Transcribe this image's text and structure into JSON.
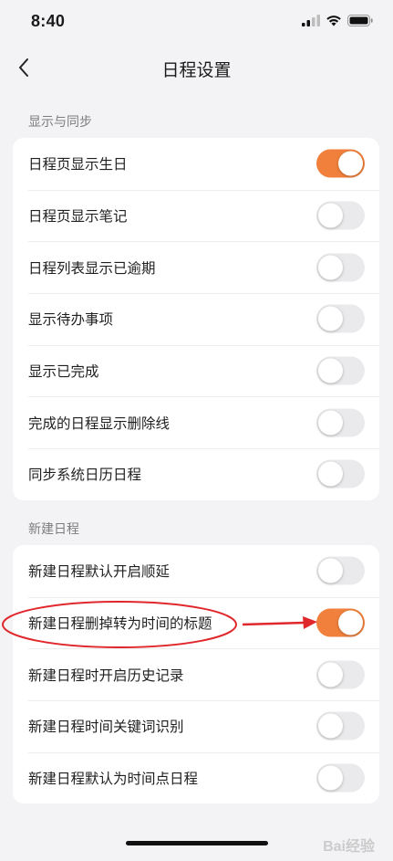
{
  "status_bar": {
    "time": "8:40"
  },
  "nav": {
    "title": "日程设置"
  },
  "sections": [
    {
      "header": "显示与同步",
      "items": [
        {
          "label": "日程页显示生日",
          "on": true
        },
        {
          "label": "日程页显示笔记",
          "on": false
        },
        {
          "label": "日程列表显示已逾期",
          "on": false
        },
        {
          "label": "显示待办事项",
          "on": false
        },
        {
          "label": "显示已完成",
          "on": false
        },
        {
          "label": "完成的日程显示删除线",
          "on": false
        },
        {
          "label": "同步系统日历日程",
          "on": false
        }
      ]
    },
    {
      "header": "新建日程",
      "items": [
        {
          "label": "新建日程默认开启顺延",
          "on": false
        },
        {
          "label": "新建日程删掉转为时间的标题",
          "on": true
        },
        {
          "label": "新建日程时开启历史记录",
          "on": false
        },
        {
          "label": "新建日程时间关键词识别",
          "on": false
        },
        {
          "label": "新建日程默认为时间点日程",
          "on": false
        }
      ]
    }
  ],
  "watermark": "Bai经验",
  "colors": {
    "accent": "#f0803c",
    "annotation": "#e0282c",
    "background": "#f3f3f5"
  }
}
